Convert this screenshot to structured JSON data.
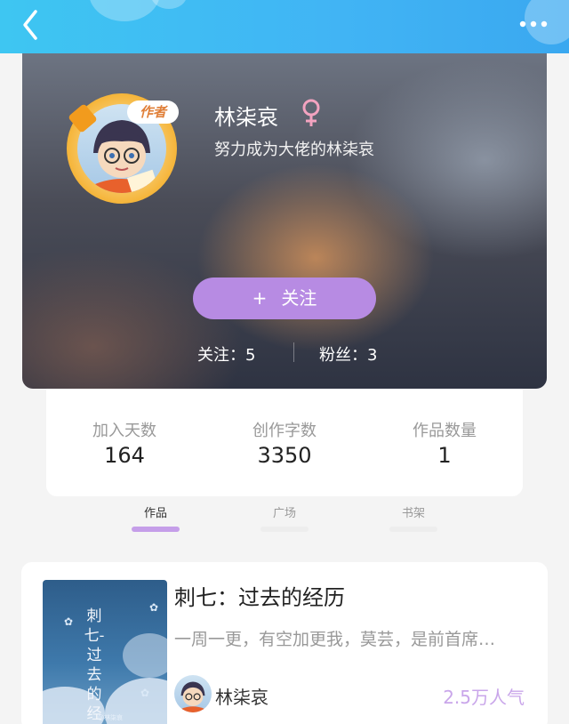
{
  "header": {
    "back_icon": "chevron-left-icon",
    "more_icon": "more-dots-icon"
  },
  "profile": {
    "badge": "作者",
    "name": "林柒哀",
    "gender_icon": "female-icon",
    "signature": "努力成为大佬的林柒哀",
    "follow_button": "关注",
    "follows_text": "关注：5",
    "fans_text": "粉丝：3"
  },
  "stats": [
    {
      "label": "加入天数",
      "value": "164"
    },
    {
      "label": "创作字数",
      "value": "3350"
    },
    {
      "label": "作品数量",
      "value": "1"
    }
  ],
  "tabs": [
    {
      "label": "作品",
      "active": true
    },
    {
      "label": "广场",
      "active": false
    },
    {
      "label": "书架",
      "active": false
    }
  ],
  "works": [
    {
      "cover_title": "刺七-过去的经历",
      "cover_credit": "@林柒哀",
      "title": "刺七：过去的经历",
      "description": "一周一更，有空加更我，莫芸，是前首席…",
      "author": "林柒哀",
      "popularity": "2.5万人气"
    }
  ],
  "colors": {
    "topbar": "#3ec6f2",
    "follow_button": "#b78be3",
    "accent": "#c59ee9",
    "popularity": "#c9a6ea"
  }
}
